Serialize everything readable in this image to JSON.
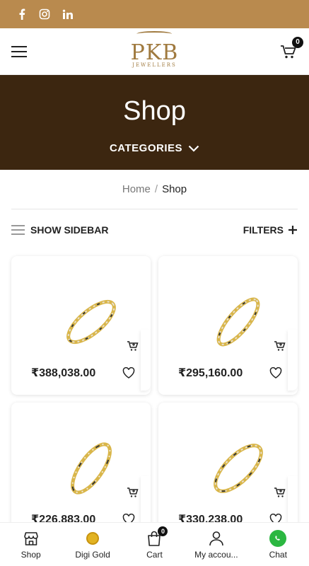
{
  "topbar": {
    "social": [
      "facebook-icon",
      "instagram-icon",
      "linkedin-icon"
    ],
    "color": "#b98a4e"
  },
  "header": {
    "logo_text": "PKB",
    "logo_sub": "JEWELLERS",
    "cart_count": "0"
  },
  "hero": {
    "title": "Shop",
    "categories_label": "CATEGORIES",
    "bg": "#3c2610"
  },
  "breadcrumb": {
    "home": "Home",
    "sep": "/",
    "current": "Shop"
  },
  "toolbar": {
    "sidebar_label": "SHOW SIDEBAR",
    "filters_label": "FILTERS"
  },
  "products": [
    {
      "price": "₹388,038.00"
    },
    {
      "price": "₹295,160.00"
    },
    {
      "price": "₹226,883.00"
    },
    {
      "price": "₹330,238.00"
    }
  ],
  "bottom_nav": {
    "items": [
      {
        "label": "Shop",
        "icon": "store-icon"
      },
      {
        "label": "Digi Gold",
        "icon": "gold-coin-icon"
      },
      {
        "label": "Cart",
        "icon": "cart-icon",
        "badge": "0"
      },
      {
        "label": "My accou...",
        "icon": "user-icon"
      },
      {
        "label": "Chat",
        "icon": "whatsapp-icon"
      }
    ]
  }
}
